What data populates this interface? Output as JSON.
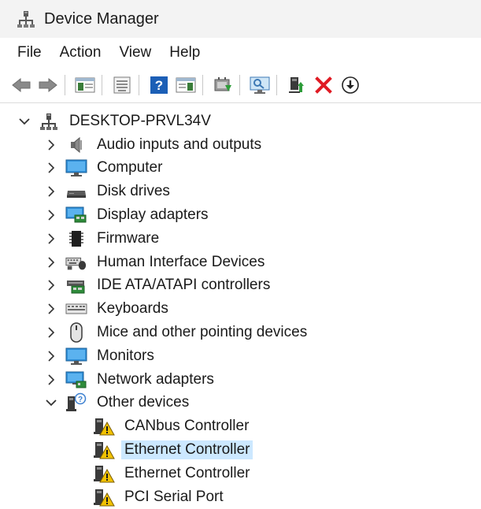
{
  "window": {
    "title": "Device Manager",
    "icon": "device-manager-icon"
  },
  "menu": [
    "File",
    "Action",
    "View",
    "Help"
  ],
  "toolbar": {
    "buttons": [
      "back-arrow-icon",
      "forward-arrow-icon",
      "show-hide-console-tree-icon",
      "properties-icon",
      "help-icon",
      "action-pane-icon",
      "update-driver-icon",
      "scan-hardware-icon",
      "enable-device-icon",
      "uninstall-device-icon",
      "download-icon"
    ],
    "colors": {
      "arrow": "#6c6c6c",
      "help": "#1c5fb6",
      "red_x": "#e01b24",
      "green": "#2e9d3a"
    }
  },
  "tree": {
    "root": {
      "label": "DESKTOP-PRVL34V",
      "expanded": true,
      "icon": "computer-tower-icon"
    },
    "categories": [
      {
        "label": "Audio inputs and outputs",
        "icon": "speaker-icon",
        "expanded": false
      },
      {
        "label": "Computer",
        "icon": "monitor-icon",
        "expanded": false
      },
      {
        "label": "Disk drives",
        "icon": "disk-drive-icon",
        "expanded": false
      },
      {
        "label": "Display adapters",
        "icon": "display-adapter-icon",
        "expanded": false
      },
      {
        "label": "Firmware",
        "icon": "chip-icon",
        "expanded": false
      },
      {
        "label": "Human Interface Devices",
        "icon": "hid-icon",
        "expanded": false
      },
      {
        "label": "IDE ATA/ATAPI controllers",
        "icon": "ide-controller-icon",
        "expanded": false
      },
      {
        "label": "Keyboards",
        "icon": "keyboard-icon",
        "expanded": false
      },
      {
        "label": "Mice and other pointing devices",
        "icon": "mouse-icon",
        "expanded": false
      },
      {
        "label": "Monitors",
        "icon": "monitor-icon",
        "expanded": false
      },
      {
        "label": "Network adapters",
        "icon": "network-adapter-icon",
        "expanded": false
      },
      {
        "label": "Other devices",
        "icon": "unknown-device-icon",
        "expanded": true
      }
    ],
    "other_devices": [
      {
        "label": "CANbus Controller",
        "icon": "warning-device-icon",
        "selected": false
      },
      {
        "label": "Ethernet Controller",
        "icon": "warning-device-icon",
        "selected": true
      },
      {
        "label": "Ethernet Controller",
        "icon": "warning-device-icon",
        "selected": false
      },
      {
        "label": "PCI Serial Port",
        "icon": "warning-device-icon",
        "selected": false
      }
    ],
    "selection_color": "#cce8ff"
  }
}
